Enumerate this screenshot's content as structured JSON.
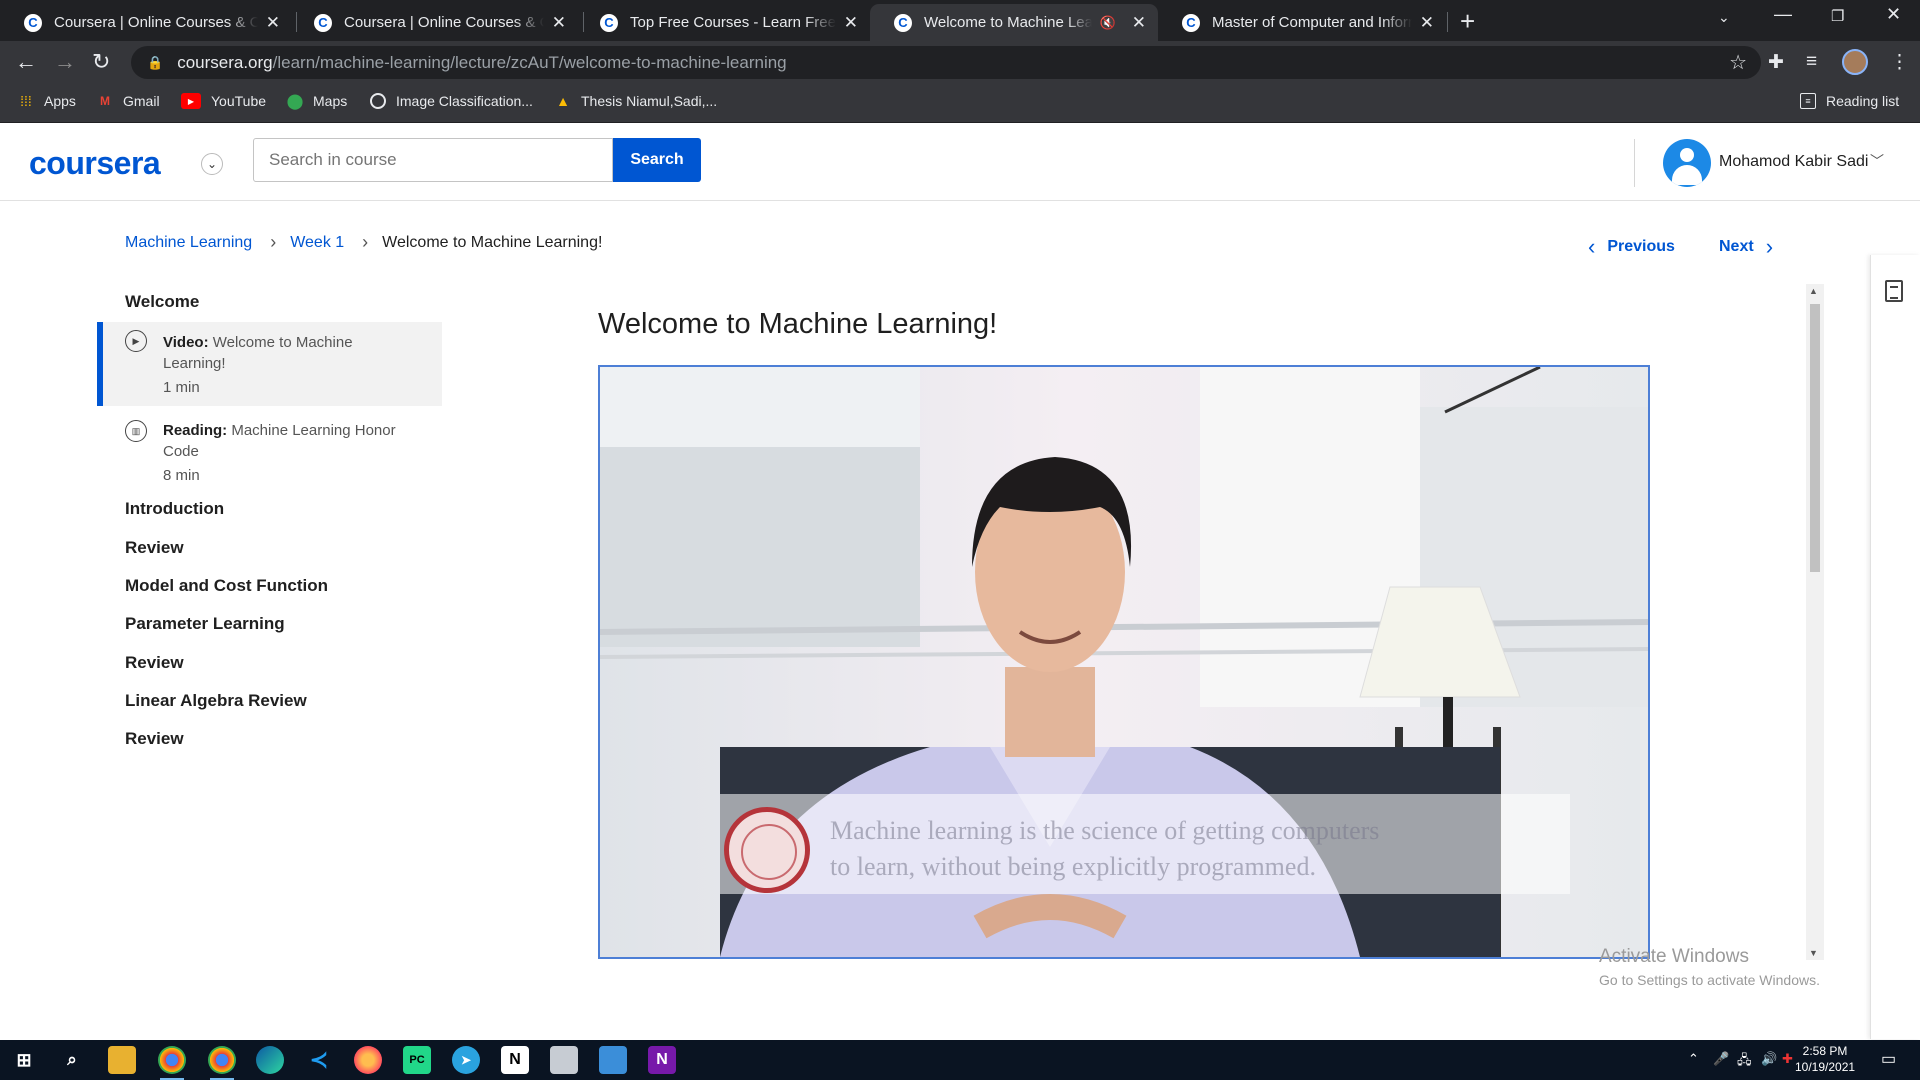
{
  "browser": {
    "tabs": [
      {
        "title": "Coursera | Online Courses & Credentials From Top Educators",
        "active": false,
        "muted": false
      },
      {
        "title": "Coursera | Online Courses & Credentials From Top Educators",
        "active": false,
        "muted": false
      },
      {
        "title": "Top Free Courses - Learn Free Online Courses",
        "active": false,
        "muted": false
      },
      {
        "title": "Welcome to Machine Learning! - Introduction",
        "active": true,
        "muted": true
      },
      {
        "title": "Master of Computer and Information Technology",
        "active": false,
        "muted": false
      }
    ],
    "favicon_letter": "C",
    "url_host": "coursera.org",
    "url_path": "/learn/machine-learning/lecture/zcAuT/welcome-to-machine-learning",
    "bookmarks": [
      {
        "label": "Apps",
        "icon": "apps-grid-icon"
      },
      {
        "label": "Gmail",
        "icon": "gmail-icon"
      },
      {
        "label": "YouTube",
        "icon": "youtube-icon"
      },
      {
        "label": "Maps",
        "icon": "maps-icon"
      },
      {
        "label": "Image Classification...",
        "icon": "globe-icon"
      },
      {
        "label": "Thesis Niamul,Sadi,...",
        "icon": "drive-icon"
      }
    ],
    "reading_list": "Reading list"
  },
  "header": {
    "logo": "coursera",
    "search_placeholder": "Search in course",
    "search_button": "Search",
    "user_name": "Mohamod Kabir Sadi"
  },
  "breadcrumb": {
    "course": "Machine Learning",
    "week": "Week 1",
    "current": "Welcome to Machine Learning!"
  },
  "nav": {
    "previous": "Previous",
    "next": "Next"
  },
  "sidebar": {
    "welcome": "Welcome",
    "items": [
      {
        "type": "Video:",
        "title": "Welcome to Machine",
        "title2": "Learning!",
        "duration": "1 min"
      },
      {
        "type": "Reading:",
        "title": "Machine Learning Honor",
        "title2": "Code",
        "duration": "8 min"
      }
    ],
    "sections": [
      "Introduction",
      "Review",
      "Model and Cost Function",
      "Parameter Learning",
      "Review",
      "Linear Algebra Review",
      "Review"
    ]
  },
  "lecture": {
    "title": "Welcome to Machine Learning!",
    "caption_line1": "Machine learning is the science of getting computers",
    "caption_line2": "to learn, without being explicitly programmed."
  },
  "watermark": {
    "line1": "Activate Windows",
    "line2": "Go to Settings to activate Windows."
  },
  "taskbar": {
    "time": "2:58 PM",
    "date": "10/19/2021"
  },
  "colors": {
    "brand": "#0056d2",
    "chrome_dark": "#202124",
    "chrome_mid": "#35363a"
  }
}
